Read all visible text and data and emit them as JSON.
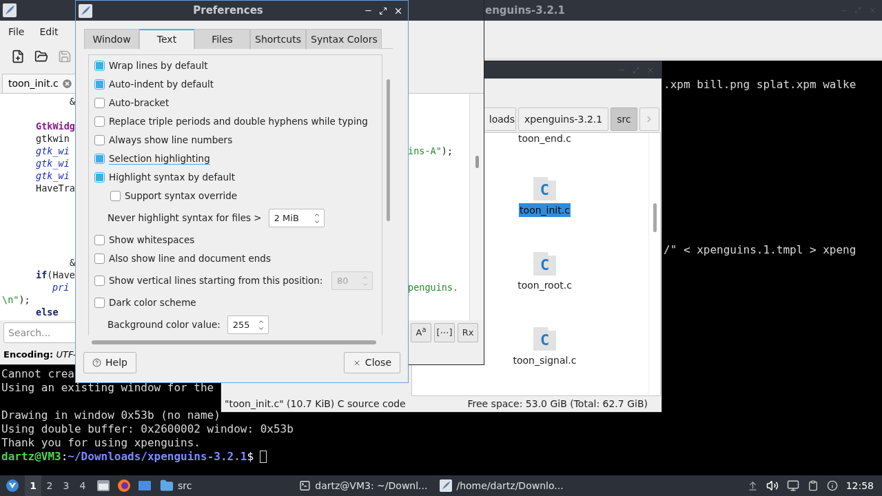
{
  "terminal": {
    "title": "enguins-3.2.1",
    "upper_lines": [
      ".xpm bill.png splat.xpm walke",
      "/\" < xpenguins.1.tmpl > xpeng"
    ],
    "lower_lines": [
      {
        "kind": "text",
        "text": "Cannot crea"
      },
      {
        "kind": "text",
        "text": "Using an existing window for the"
      },
      {
        "kind": "blank"
      },
      {
        "kind": "text",
        "text": "Drawing in window 0x53b (no name)"
      },
      {
        "kind": "text",
        "text": "Using double buffer: 0x2600002 window: 0x53b"
      },
      {
        "kind": "text",
        "text": "Thank you for using xpenguins."
      }
    ],
    "prompt": {
      "user": "dartz@VM3",
      "separator": ":",
      "path": "~/Downloads/xpenguins-3.2.1",
      "symbol": "$"
    }
  },
  "file_manager": {
    "path": [
      {
        "label": "loads",
        "selected": false
      },
      {
        "label": "xpenguins-3.2.1",
        "selected": false
      },
      {
        "label": "src",
        "selected": true
      }
    ],
    "files": [
      {
        "kind": "cut",
        "name": "toon_end.c",
        "selected": false
      },
      {
        "kind": "file",
        "name": "toon_init.c",
        "glyph": "C",
        "selected": true
      },
      {
        "kind": "file",
        "name": "toon_root.c",
        "glyph": "C",
        "selected": false
      },
      {
        "kind": "file",
        "name": "toon_signal.c",
        "glyph": "C",
        "selected": false
      }
    ],
    "status_left": "\"toon_init.c\" (10.7 KiB) C source code",
    "status_right": "Free space: 53.0 GiB (Total: 62.7 GiB)"
  },
  "editor": {
    "menu": [
      "File",
      "Edit"
    ],
    "tab": "toon_init.c",
    "code": [
      {
        "kind": "continuation",
        "left": [
          {
            "text": "&",
            "kind": "plain"
          }
        ]
      },
      {
        "kind": "blank"
      },
      {
        "kind": "statement",
        "left": [
          {
            "text": "GtkWidg",
            "kind": "type"
          }
        ]
      },
      {
        "kind": "statement",
        "left": [
          {
            "text": "gtkwin",
            "kind": "plain"
          }
        ]
      },
      {
        "kind": "statement",
        "left": [
          {
            "text": "gtk_wi",
            "kind": "func"
          }
        ],
        "right": [
          {
            "text": "ins-A\"",
            "kind": "string"
          },
          {
            "text": ");",
            "kind": "plain"
          }
        ]
      },
      {
        "kind": "statement",
        "left": [
          {
            "text": "gtk_wi",
            "kind": "func"
          }
        ]
      },
      {
        "kind": "statement",
        "left": [
          {
            "text": "gtk_wi",
            "kind": "func"
          }
        ]
      },
      {
        "kind": "statement",
        "left": [
          {
            "text": "HaveTra",
            "kind": "plain"
          }
        ]
      },
      {
        "kind": "blank"
      },
      {
        "kind": "blank"
      },
      {
        "kind": "blank"
      },
      {
        "kind": "blank"
      },
      {
        "kind": "blank"
      },
      {
        "kind": "continuation",
        "left": [
          {
            "text": "&",
            "kind": "plain"
          }
        ]
      },
      {
        "kind": "statement",
        "left": [
          {
            "text": "if",
            "kind": "keyword"
          },
          {
            "text": "(Have",
            "kind": "plain"
          }
        ]
      },
      {
        "kind": "body",
        "left": [
          {
            "text": "pri",
            "kind": "func"
          }
        ],
        "right": [
          {
            "text": "penguins.",
            "kind": "string"
          }
        ]
      },
      {
        "kind": "wrapped",
        "left": [
          {
            "text": "\\n\"",
            "kind": "string"
          },
          {
            "text": ");",
            "kind": "plain"
          }
        ]
      },
      {
        "kind": "statement",
        "left": [
          {
            "text": "else",
            "kind": "keyword"
          }
        ]
      }
    ],
    "search": {
      "placeholder": "Search..."
    },
    "tools": [
      "A$^{a}$",
      "[⋯]",
      "Rx"
    ],
    "status": "**Encoding:** *UTF-*"
  },
  "prefs": {
    "title": "Preferences",
    "tabs": [
      {
        "label": "Window",
        "selected": false
      },
      {
        "label": "Text",
        "selected": true
      },
      {
        "label": "Files",
        "selected": false
      },
      {
        "label": "Shortcuts",
        "selected": false
      },
      {
        "label": "Syntax Colors",
        "selected": false
      }
    ],
    "items": [
      {
        "kind": "checkbox",
        "label": "Wrap lines by default",
        "checked": true,
        "focused": false
      },
      {
        "kind": "checkbox",
        "label": "Auto-indent by default",
        "checked": true,
        "focused": false
      },
      {
        "kind": "checkbox",
        "label": "Auto-bracket",
        "checked": false,
        "focused": false
      },
      {
        "kind": "checkbox",
        "label": "Replace triple periods and double hyphens while typing",
        "checked": false,
        "focused": false
      },
      {
        "kind": "checkbox",
        "label": "Always show line numbers",
        "checked": false,
        "focused": false
      },
      {
        "kind": "checkbox",
        "label": "Selection highlighting",
        "checked": true,
        "focused": true
      },
      {
        "kind": "checkbox",
        "label": "Highlight syntax by default",
        "checked": true,
        "focused": false,
        "children": [
          {
            "kind": "checkbox",
            "label": "Support syntax override",
            "checked": false,
            "focused": false
          }
        ]
      },
      {
        "kind": "spin",
        "label": "Never highlight syntax for files >",
        "value": "2 MiB",
        "disabled": false
      },
      {
        "kind": "checkbox",
        "label": "Show whitespaces",
        "checked": false,
        "focused": false
      },
      {
        "kind": "checkbox",
        "label": "Also show line and document ends",
        "checked": false,
        "focused": false
      },
      {
        "kind": "checkbox_spin",
        "label": "Show vertical lines starting from this position:",
        "checked": false,
        "focused": false,
        "value": "80",
        "disabled": true
      },
      {
        "kind": "checkbox",
        "label": "Dark color scheme",
        "checked": false,
        "focused": false
      },
      {
        "kind": "spin",
        "label": "Background color value:",
        "value": "255",
        "disabled": false
      }
    ],
    "buttons": [
      {
        "kind": "help",
        "label": "Help"
      },
      {
        "kind": "close",
        "label": "Close"
      }
    ]
  },
  "taskbar": {
    "workspaces": [
      {
        "label": "1",
        "selected": true
      },
      {
        "label": "2",
        "selected": false
      },
      {
        "label": "3",
        "selected": false
      },
      {
        "label": "4",
        "selected": false
      }
    ],
    "tasks": [
      {
        "kind": "folder",
        "label": "src"
      },
      {
        "kind": "terminal",
        "label": "dartz@VM3: ~/Downl..."
      },
      {
        "kind": "editor",
        "label": "/home/dartz/Downlo..."
      }
    ],
    "clock": "12:58"
  }
}
